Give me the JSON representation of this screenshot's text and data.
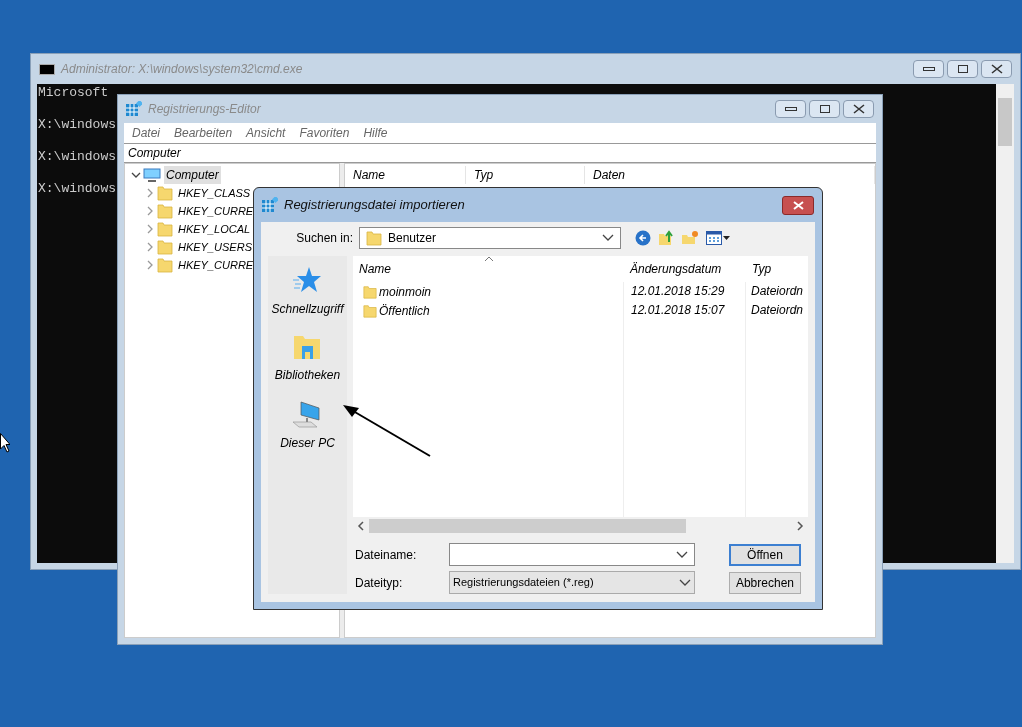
{
  "cmd_window": {
    "title": "Administrator: X:\\windows\\system32\\cmd.exe",
    "lines": [
      "Microsoft",
      "X:\\windows",
      "X:\\windows",
      "X:\\windows"
    ]
  },
  "regedit_window": {
    "title": "Registrierungs-Editor",
    "menu": [
      "Datei",
      "Bearbeiten",
      "Ansicht",
      "Favoriten",
      "Hilfe"
    ],
    "address": "Computer",
    "tree": [
      {
        "label": "Computer",
        "expanded": true,
        "selected": true,
        "children": [
          {
            "label": "HKEY_CLASS"
          },
          {
            "label": "HKEY_CURRE"
          },
          {
            "label": "HKEY_LOCAL"
          },
          {
            "label": "HKEY_USERS"
          },
          {
            "label": "HKEY_CURRE"
          }
        ]
      }
    ],
    "columns": [
      "Name",
      "Typ",
      "Daten"
    ]
  },
  "dialog": {
    "title": "Registrierungsdatei importieren",
    "look_in_label": "Suchen in:",
    "look_in_value": "Benutzer",
    "places": [
      {
        "kind": "star",
        "label": "Schnellzugriff"
      },
      {
        "kind": "library",
        "label": "Bibliotheken"
      },
      {
        "kind": "pc",
        "label": "Dieser PC"
      }
    ],
    "columns": [
      "Name",
      "Änderungsdatum",
      "Typ"
    ],
    "files": [
      {
        "name": "moinmoin",
        "date": "12.01.2018 15:29",
        "type": "Dateiordn"
      },
      {
        "name": "Öffentlich",
        "date": "12.01.2018 15:07",
        "type": "Dateiordn"
      }
    ],
    "filename_label": "Dateiname:",
    "filetype_label": "Dateityp:",
    "filetype_value": "Registrierungsdateien (*.reg)",
    "buttons": [
      "Öffnen",
      "Abbrechen"
    ]
  }
}
